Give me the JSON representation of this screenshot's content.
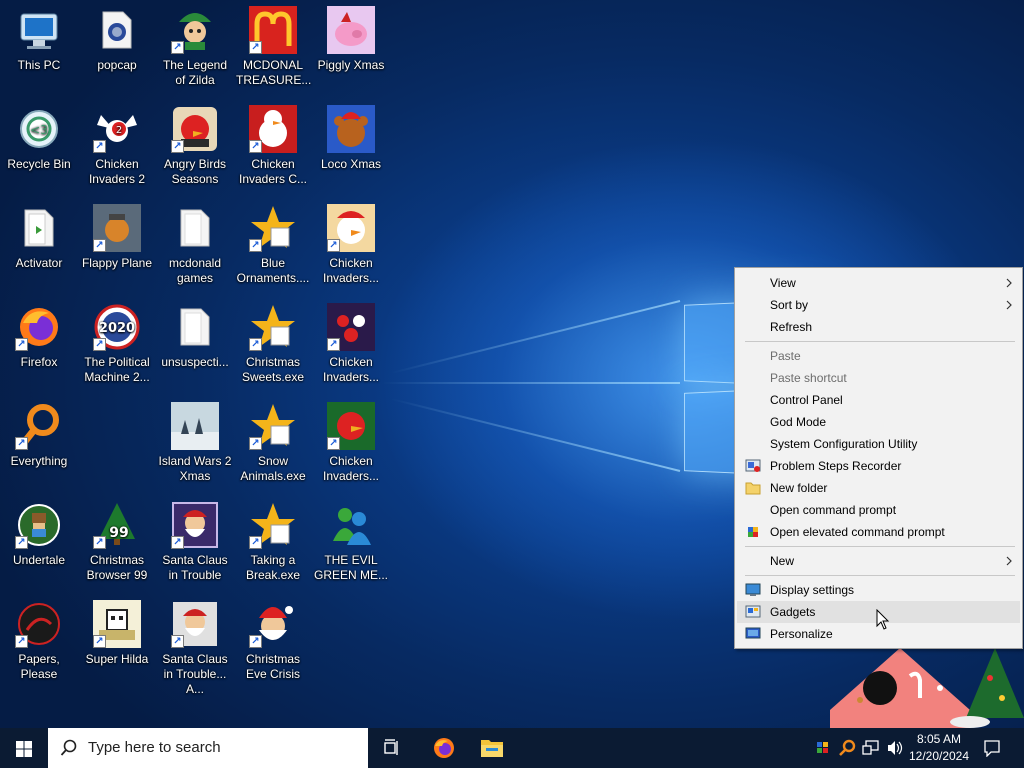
{
  "desktop": {
    "icons": [
      {
        "label": "This PC"
      },
      {
        "label": "popcap"
      },
      {
        "label": "The Legend of Zilda"
      },
      {
        "label": "MCDONAL TREASURE..."
      },
      {
        "label": "Piggly Xmas"
      },
      {
        "label": "Recycle Bin"
      },
      {
        "label": "Chicken Invaders 2"
      },
      {
        "label": "Angry Birds Seasons"
      },
      {
        "label": "Chicken Invaders C..."
      },
      {
        "label": "Loco Xmas"
      },
      {
        "label": "Activator"
      },
      {
        "label": "Flappy Plane"
      },
      {
        "label": "mcdonald games"
      },
      {
        "label": "Blue Ornaments...."
      },
      {
        "label": "Chicken Invaders..."
      },
      {
        "label": "Firefox"
      },
      {
        "label": "The Political Machine 2..."
      },
      {
        "label": "unsuspecti..."
      },
      {
        "label": "Christmas Sweets.exe"
      },
      {
        "label": "Chicken Invaders..."
      },
      {
        "label": "Everything"
      },
      {
        "label": "Island Wars 2 Xmas"
      },
      {
        "label": "Snow Animals.exe"
      },
      {
        "label": "Chicken Invaders..."
      },
      {
        "label": "Undertale"
      },
      {
        "label": "Christmas Browser 99"
      },
      {
        "label": "Santa Claus in Trouble"
      },
      {
        "label": "Taking a Break.exe"
      },
      {
        "label": "THE EVIL GREEN ME..."
      },
      {
        "label": "Papers, Please"
      },
      {
        "label": "Super Hilda"
      },
      {
        "label": "Santa Claus in Trouble... A..."
      },
      {
        "label": "Christmas Eve Crisis"
      }
    ]
  },
  "context_menu": {
    "items": [
      {
        "label": "View"
      },
      {
        "label": "Sort by"
      },
      {
        "label": "Refresh"
      },
      {
        "label": "Paste"
      },
      {
        "label": "Paste shortcut"
      },
      {
        "label": "Control Panel"
      },
      {
        "label": "God Mode"
      },
      {
        "label": "System Configuration Utility"
      },
      {
        "label": "Problem Steps Recorder"
      },
      {
        "label": "New folder"
      },
      {
        "label": "Open command prompt"
      },
      {
        "label": "Open elevated command prompt"
      },
      {
        "label": "New"
      },
      {
        "label": "Display settings"
      },
      {
        "label": "Gadgets"
      },
      {
        "label": "Personalize"
      }
    ]
  },
  "taskbar": {
    "search_placeholder": "Type here to search",
    "time": "8:05 AM",
    "date": "12/20/2024"
  },
  "colors": {
    "taskbar": "#0b1b33",
    "menu_bg": "#f2f2f2",
    "menu_hover": "#e1e1e1",
    "disabled_text": "#6d6d6d"
  }
}
